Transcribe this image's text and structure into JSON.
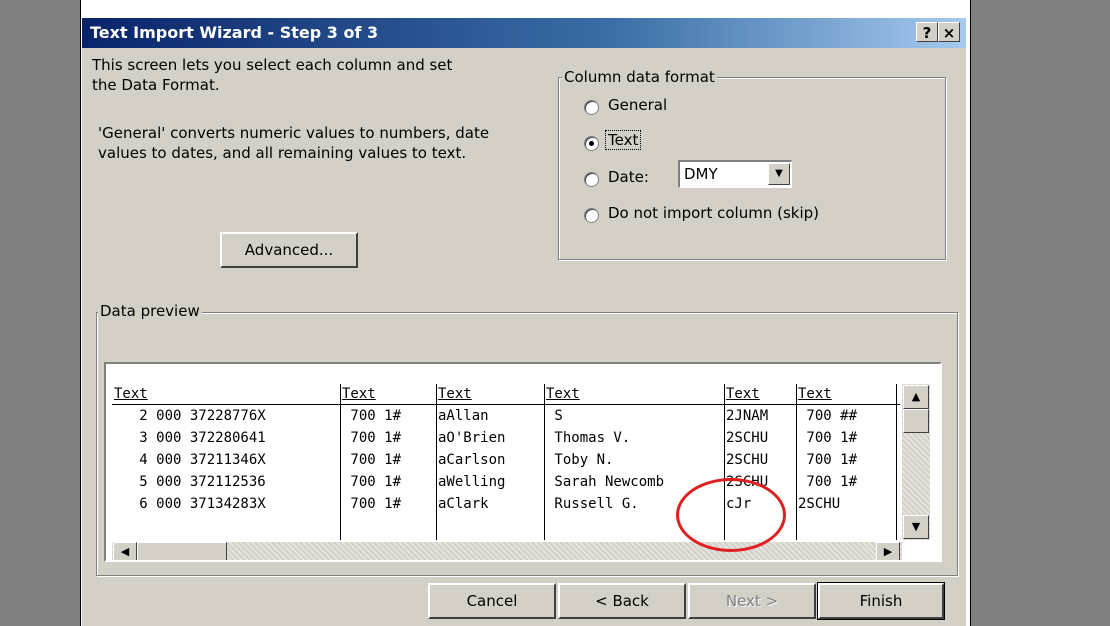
{
  "window": {
    "title": "Text Import Wizard - Step 3 of 3",
    "help_label": "?",
    "close_label": "×"
  },
  "intro": {
    "line1": "This screen lets you select each column and set",
    "line2": "the Data Format.",
    "desc1": "'General' converts numeric values to numbers, date",
    "desc2": "values to dates, and all remaining values to text."
  },
  "advanced_button": "Advanced...",
  "column_format": {
    "label": "Column data format",
    "options": [
      {
        "label": "General",
        "checked": false
      },
      {
        "label": "Text",
        "checked": true
      },
      {
        "label": "Date:",
        "checked": false
      },
      {
        "label": "Do not import column (skip)",
        "checked": false
      }
    ],
    "date_value": "DMY"
  },
  "preview": {
    "label": "Data preview",
    "headers": [
      "Text",
      "Text",
      "Text",
      "Text",
      "Text",
      "Text"
    ],
    "rows": [
      [
        "   2 000 37228776X",
        " 700 1#",
        "aAllan  ",
        " S           ",
        "2JNAM",
        " 700 ##"
      ],
      [
        "   3 000 372280641",
        " 700 1#",
        "aO'Brien",
        " Thomas V.   ",
        "2SCHU",
        " 700 1#"
      ],
      [
        "   4 000 37211346X",
        " 700 1#",
        "aCarlson",
        " Toby N.     ",
        "2SCHU",
        " 700 1#"
      ],
      [
        "   5 000 372112536",
        " 700 1#",
        "aWelling",
        " Sarah Newcomb",
        "2SCHU",
        " 700 1#"
      ],
      [
        "   6 000 37134283X",
        " 700 1#",
        "aClark  ",
        " Russell G.  ",
        "cJr  ",
        "2SCHU  "
      ]
    ]
  },
  "buttons": {
    "cancel": "Cancel",
    "back": "< Back",
    "next": "Next >",
    "finish": "Finish"
  },
  "colors": {
    "annotation": "#e02020",
    "title_bar": "#0a246a",
    "dialog_face": "#d4d0c8"
  }
}
